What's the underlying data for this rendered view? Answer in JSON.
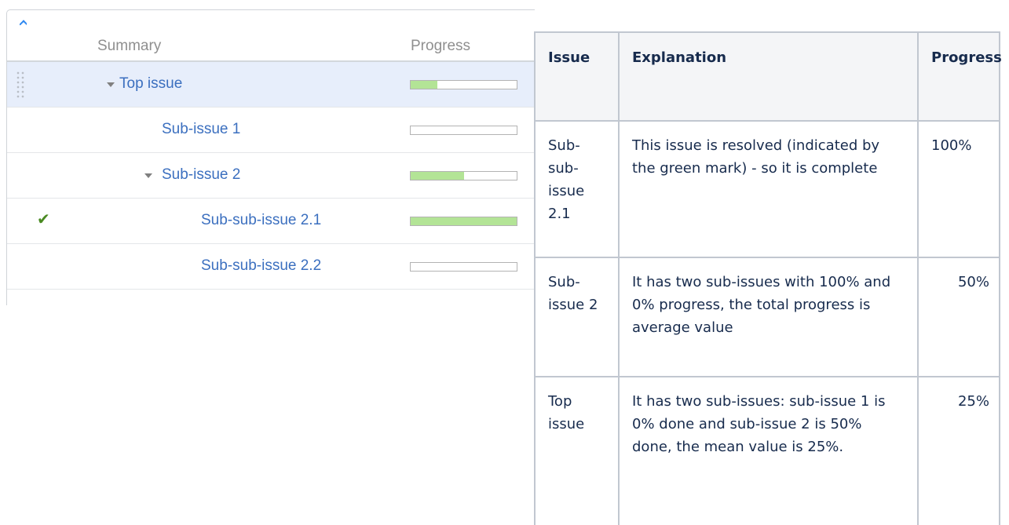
{
  "grid": {
    "headers": {
      "summary": "Summary",
      "progress": "Progress"
    },
    "rows": [
      {
        "name": "Top issue",
        "expandable": true,
        "resolved": false,
        "selected": true,
        "progress": 0.25
      },
      {
        "name": "Sub-issue 1",
        "expandable": false,
        "resolved": false,
        "selected": false,
        "progress": 0.0
      },
      {
        "name": "Sub-issue 2",
        "expandable": true,
        "resolved": false,
        "selected": false,
        "progress": 0.5
      },
      {
        "name": "Sub-sub-issue 2.1",
        "expandable": false,
        "resolved": true,
        "selected": false,
        "progress": 1.0
      },
      {
        "name": "Sub-sub-issue 2.2",
        "expandable": false,
        "resolved": false,
        "selected": false,
        "progress": 0.0
      }
    ],
    "icons": {
      "collapse": "chevron-up-icon",
      "drag": "drag-handle-icon",
      "expand": "caret-down-icon",
      "resolved": "checkmark-icon"
    },
    "colors": {
      "link": "#3b6fbf",
      "progress_fill": "#b3e496",
      "resolved_mark": "#4a8a22",
      "selected_row": "#e7eefb",
      "caret": "#2d87f0"
    }
  },
  "table": {
    "headers": {
      "issue": "Issue",
      "explanation": "Explanation",
      "progress": "Progress"
    },
    "rows": [
      {
        "issue": "Sub-sub-issue 2.1",
        "explanation": "This issue is resolved (indicated by the green mark) - so it is complete",
        "progress": "100%"
      },
      {
        "issue": "Sub-issue 2",
        "explanation": "It has two sub-issues with 100% and 0% progress, the total progress is average value",
        "progress": "50%"
      },
      {
        "issue": "Top issue",
        "explanation": "It has two sub-issues: sub-issue 1 is 0% done and sub-issue 2 is 50% done, the mean value is 25%.",
        "progress": "25%"
      }
    ]
  }
}
